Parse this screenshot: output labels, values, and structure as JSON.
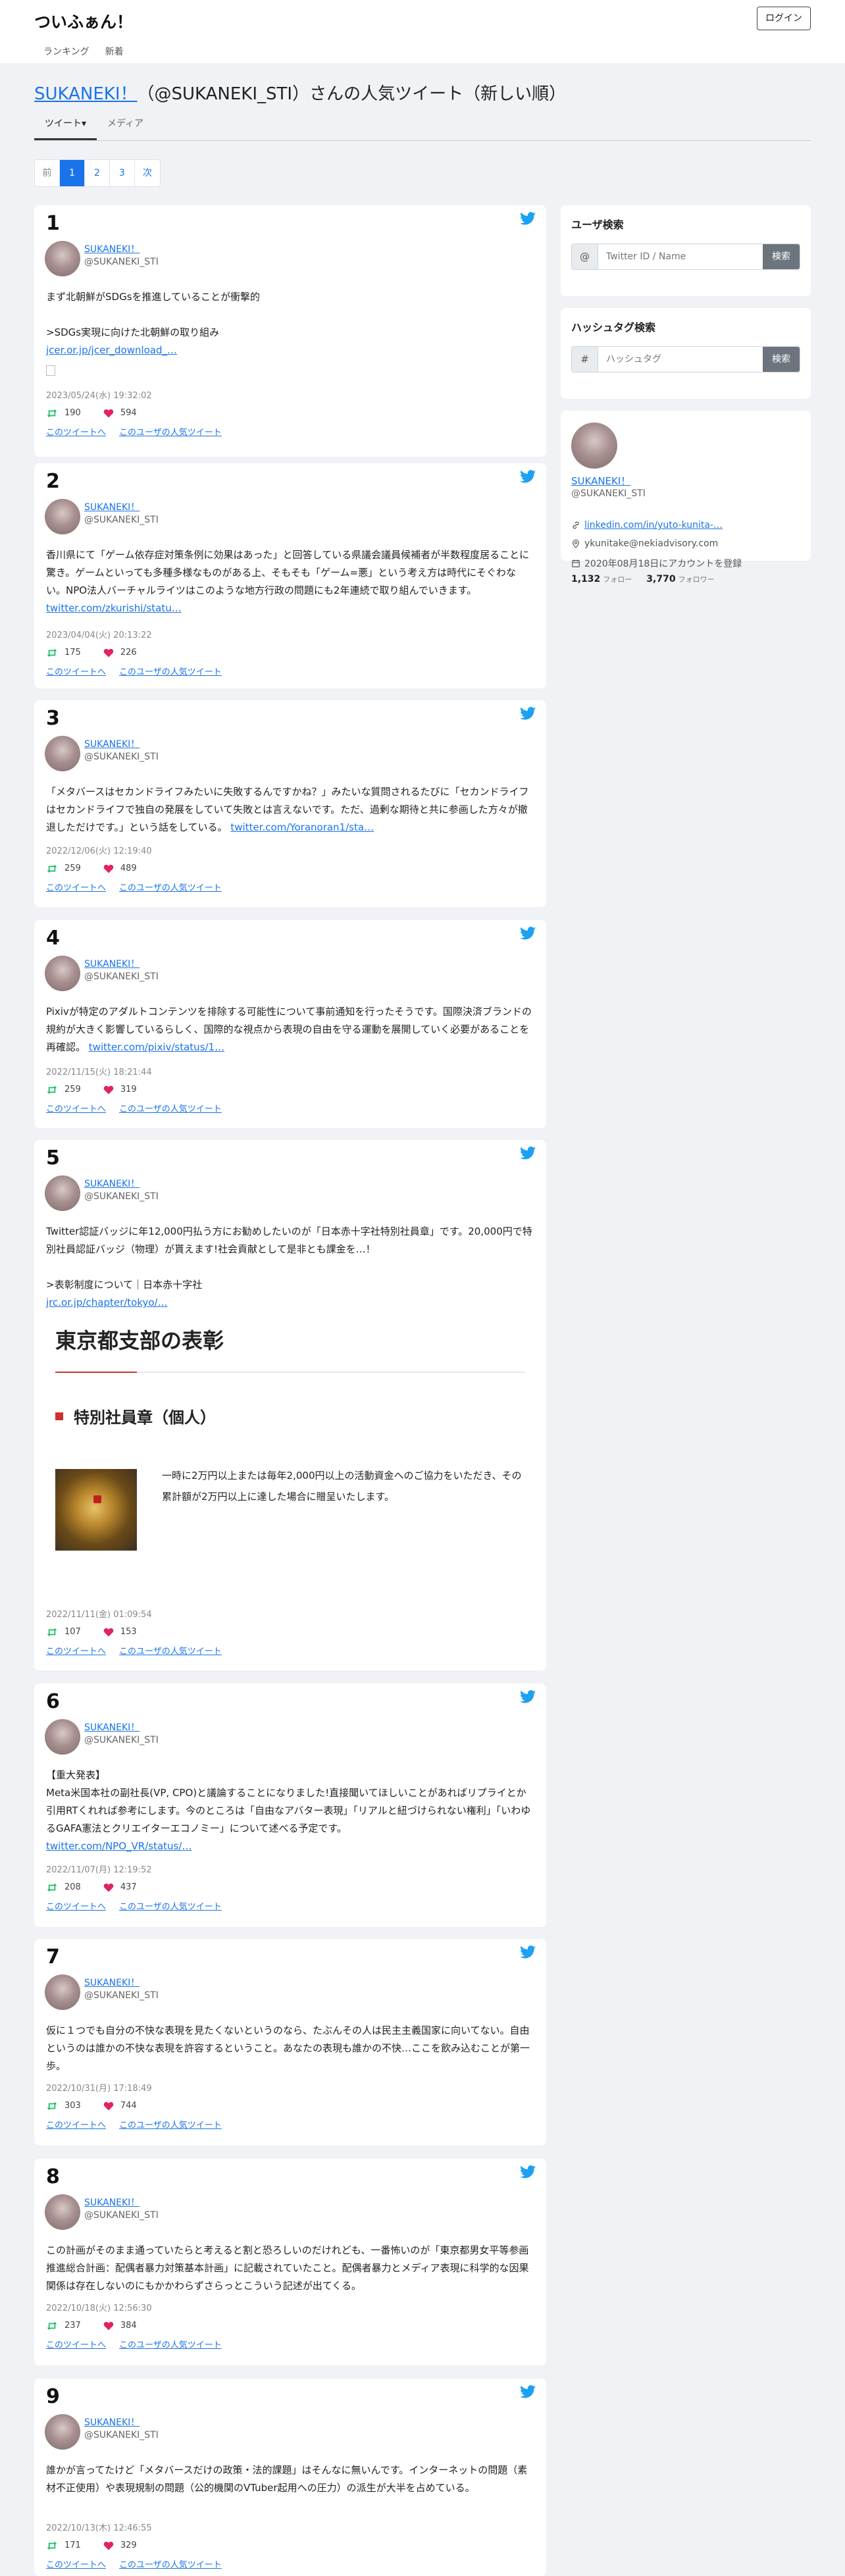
{
  "app": {
    "brand": "ついふぁん！",
    "login_label": "ログイン"
  },
  "nav": [
    "ランキング",
    "新着"
  ],
  "page": {
    "title_name": "SUKANEKI！",
    "title_rest": "（@SUKANEKI_STI）さんの人気ツイート（新しい順）"
  },
  "tabs": [
    "ツイート▾",
    "メディア"
  ],
  "pager": [
    "前",
    "1",
    "2",
    "3",
    "次"
  ],
  "colors": {
    "accent": "#1a73e8",
    "retweet": "#17bf63",
    "like": "#e0245e",
    "twitter": "#1da1f2"
  },
  "link_labels": {
    "tweet": "このツイートへ",
    "user": "このユーザの人気ツイート"
  },
  "tweets": [
    {
      "rank": "1",
      "name": "SUKANEKI！",
      "handle": "@SUKANEKI_STI",
      "text": "まず北朝鮮がSDGsを推進していることが衝撃的\n\n>SDGs実現に向けた北朝鮮の取り組み",
      "link": "jcer.or.jp/jcer_download_…",
      "date": "2023/05/24(水) 19:32:02",
      "retweets": "190",
      "likes": "594"
    },
    {
      "rank": "2",
      "name": "SUKANEKI！",
      "handle": "@SUKANEKI_STI",
      "text": "香川県にて「ゲーム依存症対策条例に効果はあった」と回答している県議会議員候補者が半数程度居ることに驚き。ゲームといっても多種多様なものがある上、そもそも「ゲーム=悪」という考え方は時代にそぐわない。NPO法人バーチャルライツはこのような地方行政の問題にも2年連続で取り組んでいきます。",
      "link": "twitter.com/zkurishi/statu…",
      "date": "2023/04/04(火) 20:13:22",
      "retweets": "175",
      "likes": "226"
    },
    {
      "rank": "3",
      "name": "SUKANEKI！",
      "handle": "@SUKANEKI_STI",
      "text": "「メタバースはセカンドライフみたいに失敗するんですかね？」みたいな質問されるたびに「セカンドライフはセカンドライフで独自の発展をしていて失敗とは言えないです。ただ、過剰な期待と共に参画した方々が撤退しただけです。」という話をしている。",
      "link": "twitter.com/Yoranoran1/sta…",
      "date": "2022/12/06(火) 12:19:40",
      "retweets": "259",
      "likes": "489"
    },
    {
      "rank": "4",
      "name": "SUKANEKI！",
      "handle": "@SUKANEKI_STI",
      "text": "Pixivが特定のアダルトコンテンツを排除する可能性について事前通知を行ったそうです。国際決済ブランドの規約が大きく影響しているらしく、国際的な視点から表現の自由を守る運動を展開していく必要があることを再確認。",
      "link": "twitter.com/pixiv/status/1…",
      "date": "2022/11/15(火) 18:21:44",
      "retweets": "259",
      "likes": "319"
    },
    {
      "rank": "5",
      "name": "SUKANEKI！",
      "handle": "@SUKANEKI_STI",
      "text": "Twitter認証バッジに年12,000円払う方にお勧めしたいのが「日本赤十字社特別社員章」です。20,000円で特別社員認証バッジ（物理）が貰えます!社会貢献として是非とも課金を…！\n\n>表彰制度について｜日本赤十字社",
      "link": "jrc.or.jp/chapter/tokyo/…",
      "embed": {
        "heading": "東京都支部の表彰",
        "subheading": "特別社員章（個人）",
        "text": "一時に2万円以上または毎年2,000円以上の活動資金へのご協力をいただき、その累計額が2万円以上に達した場合に贈呈いたします。"
      },
      "date": "2022/11/11(金) 01:09:54",
      "retweets": "107",
      "likes": "153"
    },
    {
      "rank": "6",
      "name": "SUKANEKI！",
      "handle": "@SUKANEKI_STI",
      "text": "【重大発表】\nMeta米国本社の副社長(VP, CPO)と議論することになりました!直接聞いてほしいことがあればリプライとか引用RTくれれば参考にします。今のところは「自由なアバター表現」「リアルと紐づけられない権利」「いわゆるGAFA憲法とクリエイターエコノミー」について述べる予定です。",
      "link": "twitter.com/NPO_VR/status/…",
      "date": "2022/11/07(月) 12:19:52",
      "retweets": "208",
      "likes": "437"
    },
    {
      "rank": "7",
      "name": "SUKANEKI！",
      "handle": "@SUKANEKI_STI",
      "text": "仮に１つでも自分の不快な表現を見たくないというのなら、たぶんその人は民主主義国家に向いてない。自由というのは誰かの不快な表現を許容するということ。あなたの表現も誰かの不快…ここを飲み込むことが第一歩。",
      "link": "",
      "date": "2022/10/31(月) 17:18:49",
      "retweets": "303",
      "likes": "744"
    },
    {
      "rank": "8",
      "name": "SUKANEKI！",
      "handle": "@SUKANEKI_STI",
      "text": "この計画がそのまま通っていたらと考えると割と恐ろしいのだけれども、一番怖いのが「東京都男女平等参画推進総合計画：配偶者暴力対策基本計画」に記載されていたこと。配偶者暴力とメディア表現に科学的な因果関係は存在しないのにもかかわらずさらっとこういう記述が出てくる。",
      "link": "",
      "date": "2022/10/18(火) 12:56:30",
      "retweets": "237",
      "likes": "384"
    },
    {
      "rank": "9",
      "name": "SUKANEKI！",
      "handle": "@SUKANEKI_STI",
      "text": "誰かが言ってたけど「メタバースだけの政策・法的課題」はそんなに無いんです。インターネットの問題（素材不正使用）や表現規制の問題（公的機関のVTuber起用への圧力）の派生が大半を占めている。",
      "link": "",
      "date": "2022/10/13(木) 12:46:55",
      "retweets": "171",
      "likes": "329"
    }
  ],
  "sidebar": {
    "user_search": {
      "title": "ユーザ検索",
      "prefix": "@",
      "placeholder": "Twitter ID / Name",
      "button": "検索"
    },
    "hashtag_search": {
      "title": "ハッシュタグ検索",
      "prefix": "#",
      "placeholder": "ハッシュタグ",
      "button": "検索"
    },
    "profile": {
      "name": "SUKANEKI！",
      "handle": "@SUKANEKI_STI",
      "link": "linkedin.com/in/yuto-kunita-…",
      "email": "ykunitake@nekiadvisory.com",
      "registered": "2020年08月18日にアカウントを登録",
      "following": "1,132",
      "following_label": "フォロー",
      "followers": "3,770",
      "followers_label": "フォロワー"
    }
  }
}
